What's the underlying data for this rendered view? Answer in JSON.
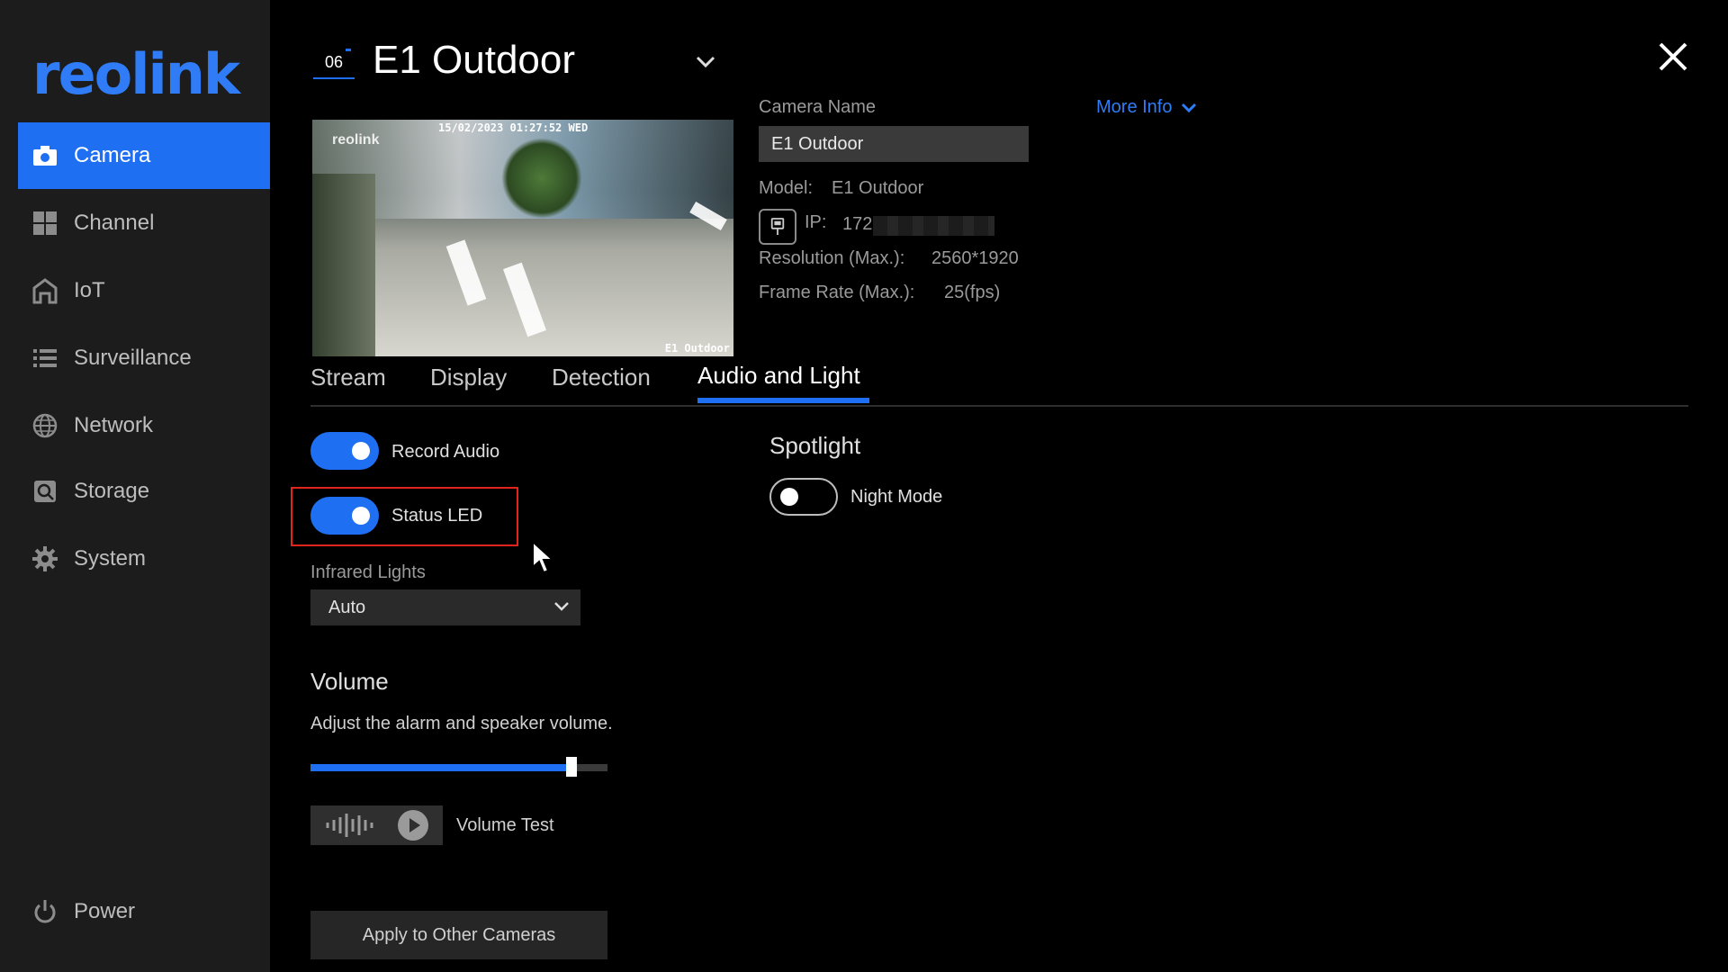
{
  "brand": {
    "logo_text": "reolink",
    "accent_color": "#1f6ff2",
    "link_color": "#2f7cf6",
    "highlight_color": "#e2231a"
  },
  "sidebar": {
    "items": [
      {
        "label": "Camera",
        "icon": "camera-icon",
        "active": true
      },
      {
        "label": "Channel",
        "icon": "channel-grid-icon",
        "active": false
      },
      {
        "label": "IoT",
        "icon": "iot-home-icon",
        "active": false
      },
      {
        "label": "Surveillance",
        "icon": "list-icon",
        "active": false
      },
      {
        "label": "Network",
        "icon": "globe-icon",
        "active": false
      },
      {
        "label": "Storage",
        "icon": "storage-icon",
        "active": false
      },
      {
        "label": "System",
        "icon": "gear-icon",
        "active": false
      }
    ],
    "power_label": "Power"
  },
  "header": {
    "channel_number": "06",
    "camera_title": "E1 Outdoor"
  },
  "preview": {
    "osd_timestamp": "15/02/2023 01:27:52 WED",
    "osd_logo": "reolink",
    "osd_camera_name": "E1 Outdoor"
  },
  "info": {
    "camera_name_label": "Camera Name",
    "camera_name_value": "E1 Outdoor",
    "more_info_label": "More Info",
    "model_label": "Model:",
    "model_value": "E1 Outdoor",
    "ip_label": "IP:",
    "ip_value_visible": "172",
    "resolution_label": "Resolution (Max.):",
    "resolution_value": "2560*1920",
    "frame_rate_label": "Frame Rate (Max.):",
    "frame_rate_value": "25(fps)"
  },
  "tabs": [
    {
      "label": "Stream",
      "active": false
    },
    {
      "label": "Display",
      "active": false
    },
    {
      "label": "Detection",
      "active": false
    },
    {
      "label": "Audio and Light",
      "active": true
    }
  ],
  "settings": {
    "record_audio": {
      "label": "Record Audio",
      "on": true
    },
    "status_led": {
      "label": "Status LED",
      "on": true
    },
    "infrared_label": "Infrared Lights",
    "infrared_value": "Auto",
    "spotlight_title": "Spotlight",
    "night_mode": {
      "label": "Night Mode",
      "on": false
    },
    "volume_title": "Volume",
    "volume_desc": "Adjust the alarm and speaker volume.",
    "volume_level": 0.88,
    "volume_test_label": "Volume Test",
    "apply_label": "Apply to Other Cameras"
  }
}
